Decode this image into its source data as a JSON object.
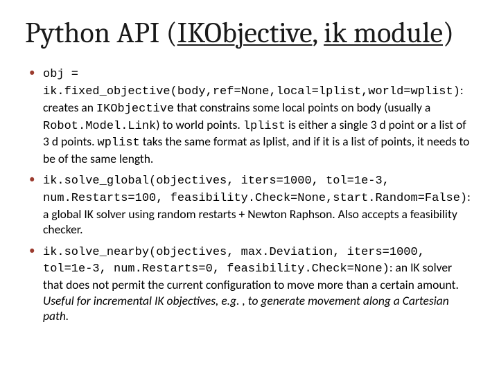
{
  "title": {
    "prefix": "Python API (",
    "link1": "IKObjective",
    "comma": ", ",
    "link2": "ik module",
    "suffix": ")"
  },
  "bullets": [
    {
      "code1": "obj = ik.fixed_objective(body,ref=None,local=lplist,world=wplist)",
      "text1": ": creates an ",
      "code2": "IKObjective",
      "text2": " that constrains some local points on body (usually a ",
      "code3": "Robot.Model.Link",
      "text3": ") to world points. ",
      "code4": "lplist",
      "text4": " is either a single 3 d point or a list of 3 d points. ",
      "code5": "wplist",
      "text5": " taks the same format as lplist, and if it is a list of points, it needs to be of the same length."
    },
    {
      "code1": "ik.solve_global(objectives, iters=1000, tol=1e-3, num.Restarts=100, feasibility.Check=None,start.Random=False)",
      "text1": ": a global IK solver using random restarts + Newton Raphson. Also accepts a feasibility checker."
    },
    {
      "code1": "ik.solve_nearby(objectives, max.Deviation, iters=1000, tol=1e-3, num.Restarts=0, feasibility.Check=None)",
      "text1": ": an IK solver that does not permit the current configuration to move more than a certain amount. ",
      "ital1": "Useful for incremental IK objectives, e.g. , to generate movement along a Cartesian path."
    }
  ]
}
